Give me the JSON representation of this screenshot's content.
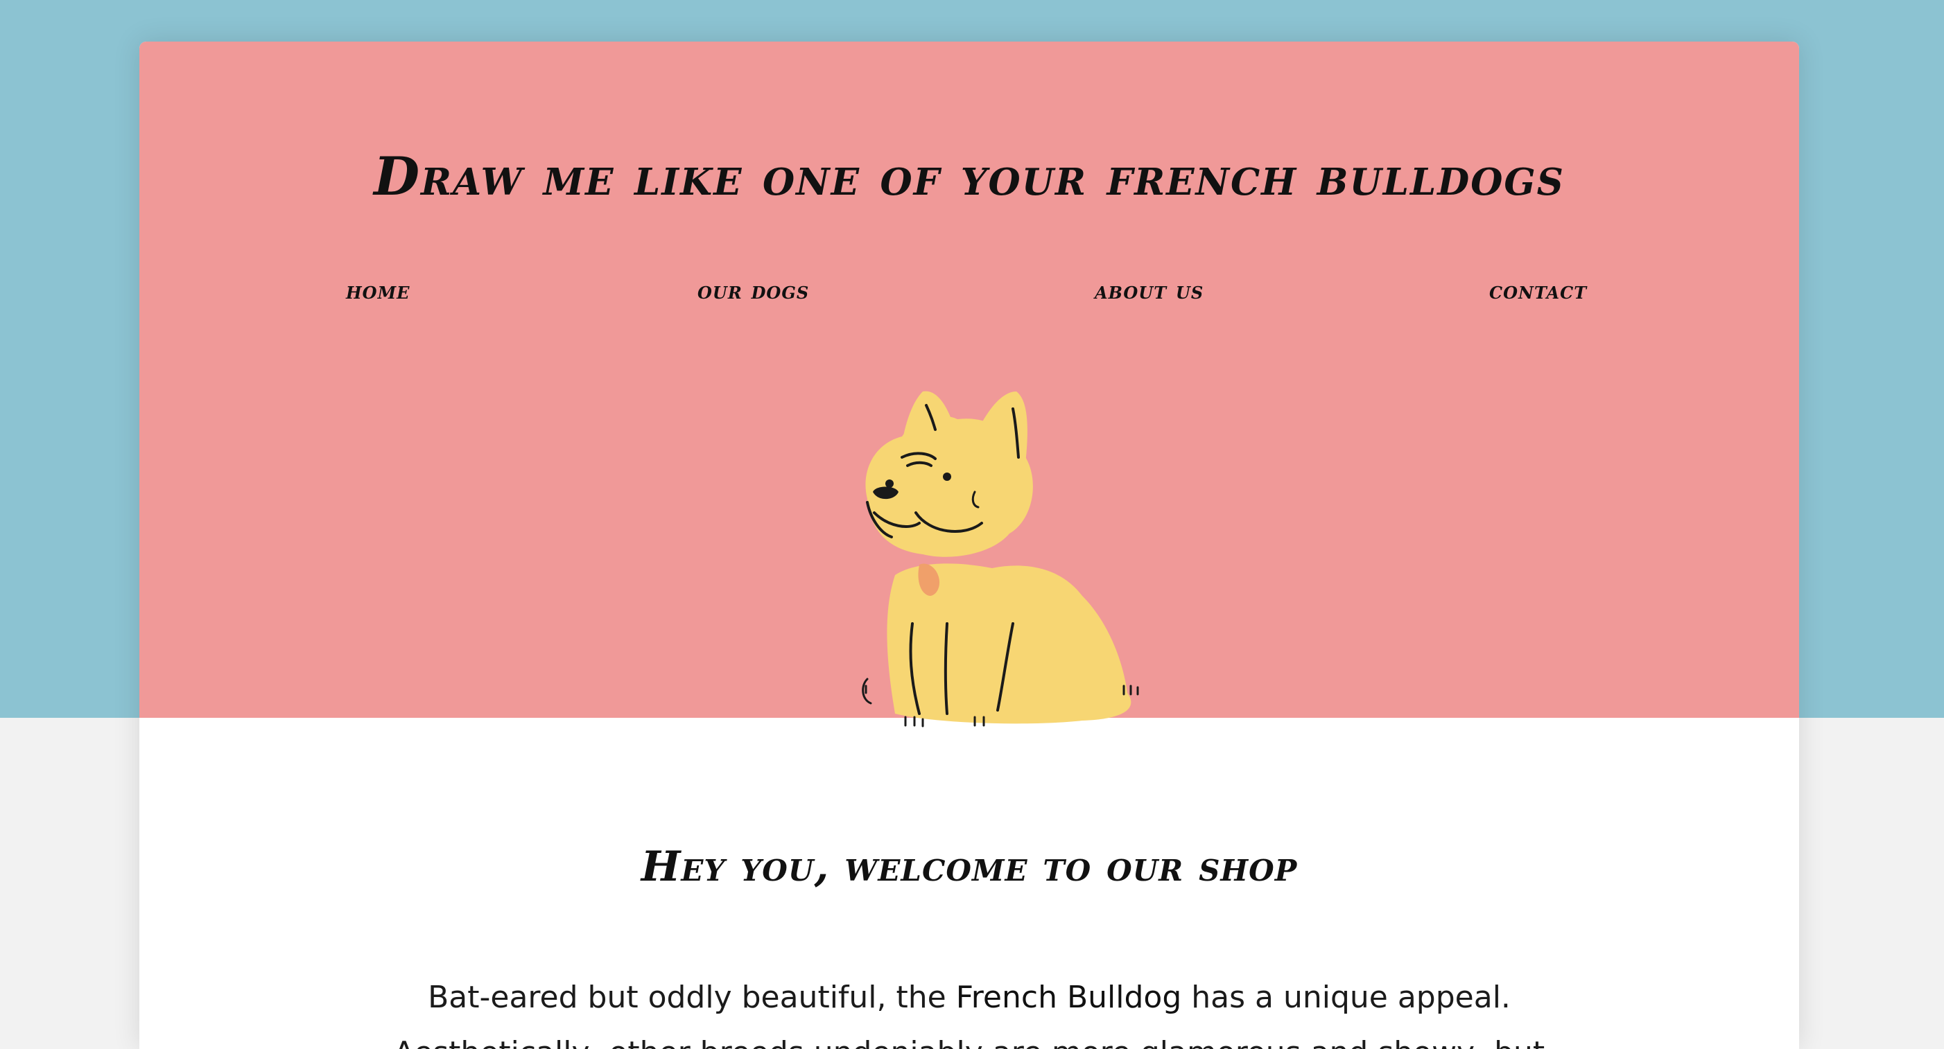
{
  "page": {
    "colors": {
      "background_top": "#8cc3d2",
      "background_bottom": "#f2f2f2",
      "hero": "#f09998",
      "card": "#ffffff",
      "dog_fill": "#f7d673",
      "dog_outline": "#1a1a1a",
      "dog_spot": "#f0a06a"
    }
  },
  "header": {
    "title": "Draw me like one of your french bulldogs"
  },
  "nav": {
    "items": [
      {
        "label": "home"
      },
      {
        "label": "our dogs"
      },
      {
        "label": "about us"
      },
      {
        "label": "contact"
      }
    ]
  },
  "hero": {
    "illustration_icon": "french-bulldog-illustration"
  },
  "main": {
    "heading": "Hey you, welcome to our shop",
    "intro_before": "Bat-eared but oddly beautiful, the ",
    "intro_highlight": "French Bulldog",
    "intro_after": " has a unique appeal. Aesthetically, other breeds undeniably are more glamorous and showy, but"
  }
}
